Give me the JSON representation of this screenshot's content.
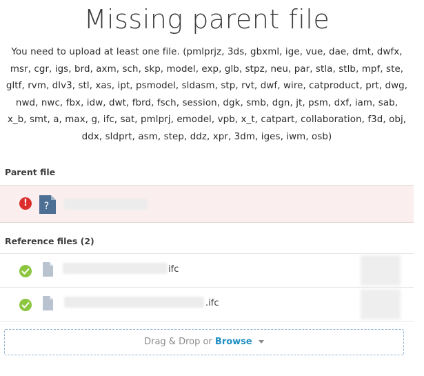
{
  "title": "Missing parent file",
  "description": "You need to upload at least one file. (pmlprjz, 3ds, gbxml, ige, vue, dae, dmt, dwfx, msr, cgr, igs, brd, axm, sch, skp, model, exp, glb, stpz, neu, par, stla, stlb, mpf, ste, gltf, rvm, dlv3, stl, xas, ipt, psmodel, sldasm, stp, rvt, dwf, wire, catproduct, prt, dwg, nwd, nwc, fbx, idw, dwt, fbrd, fsch, session, dgk, smb, dgn, jt, psm, dxf, iam, sab, x_b, smt, a, max, g, ifc, sat, pmlprj, emodel, vpb, x_t, catpart, collaboration, f3d, obj, ddx, sldprt, asm, step, ddz, xpr, 3dm, iges, iwm, osb)",
  "parent_section": {
    "label": "Parent file",
    "status_icon": "error-icon",
    "file_icon": "question-document-icon",
    "status_color": "#dd2c2c"
  },
  "reference_section": {
    "label": "Reference files (2)",
    "files": [
      {
        "extension_text": "ifc",
        "status_icon": "success-check-icon"
      },
      {
        "extension_text": ".ifc",
        "status_icon": "success-check-icon"
      }
    ],
    "status_color": "#8cc63f"
  },
  "dropzone": {
    "text": "Drag & Drop or",
    "browse_label": "Browse",
    "accent_color": "#1f8ec2"
  }
}
